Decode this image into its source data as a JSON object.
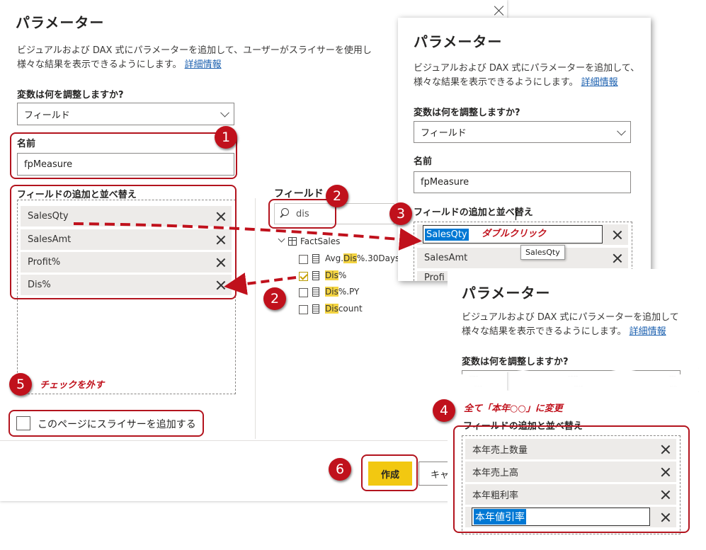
{
  "dialog_main": {
    "title": "パラメーター",
    "description_line1": "ビジュアルおよび DAX 式にパラメーターを追加して、ユーザーがスライサーを使用し",
    "description_line2": "様々な結果を表示できるようにします。",
    "details_link": "詳細情報",
    "adjust_label": "変数は何を調整しますか?",
    "adjust_value": "フィールド",
    "name_label": "名前",
    "name_value": "fpMeasure",
    "fields_label": "フィールドの追加と並べ替え",
    "fields": [
      "SalesQty",
      "SalesAmt",
      "Profit%",
      "Dis%"
    ],
    "slicer_label": "このページにスライサーを追加する",
    "create_button": "作成",
    "cancel_button": "キャ"
  },
  "fields_pane": {
    "title": "フィールド",
    "search_value": "dis",
    "table_name": "FactSales",
    "items": [
      {
        "pre": "Avg.",
        "hl": "Dis",
        "post": "%.30Days",
        "checked": false
      },
      {
        "pre": "",
        "hl": "Dis",
        "post": "%",
        "checked": true
      },
      {
        "pre": "",
        "hl": "Dis",
        "post": "%.PY",
        "checked": false
      },
      {
        "pre": "",
        "hl": "Dis",
        "post": "count",
        "checked": false
      }
    ]
  },
  "dialog_second": {
    "title": "パラメーター",
    "description_line1": "ビジュアルおよび DAX 式にパラメーターを追加して、",
    "description_line2": "様々な結果を表示できるようにします。",
    "details_link": "詳細情報",
    "adjust_label": "変数は何を調整しますか?",
    "adjust_value": "フィールド",
    "name_label": "名前",
    "name_value": "fpMeasure",
    "fields_label": "フィールドの追加と並べ替え",
    "editing_value": "SalesQty",
    "second_item": "SalesAmt",
    "third_item_partial": "Profi",
    "tooltip": "SalesQty"
  },
  "dialog_third": {
    "title": "パラメーター",
    "description_line1": "ビジュアルおよび DAX 式にパラメーターを追加して",
    "description_line2": "様々な結果を表示できるようにします。",
    "details_link": "詳細情報",
    "adjust_label": "変数は何を調整しますか?",
    "fields_label": "フィールドの追加と並べ替え",
    "fields": [
      "本年売上数量",
      "本年売上高",
      "本年粗利率"
    ],
    "editing_value": "本年値引率"
  },
  "annotations": {
    "badge1": "1",
    "badge2a": "2",
    "badge2b": "2",
    "badge3": "3",
    "badge4": "4",
    "badge5": "5",
    "badge6": "6",
    "double_click": "ダブルクリック",
    "uncheck": "チェックを外す",
    "rename_all": "全て「本年○○」に変更"
  },
  "colors": {
    "accent_red": "#c0111c",
    "create_button": "#f2c811",
    "selection_blue": "#0078d4"
  }
}
